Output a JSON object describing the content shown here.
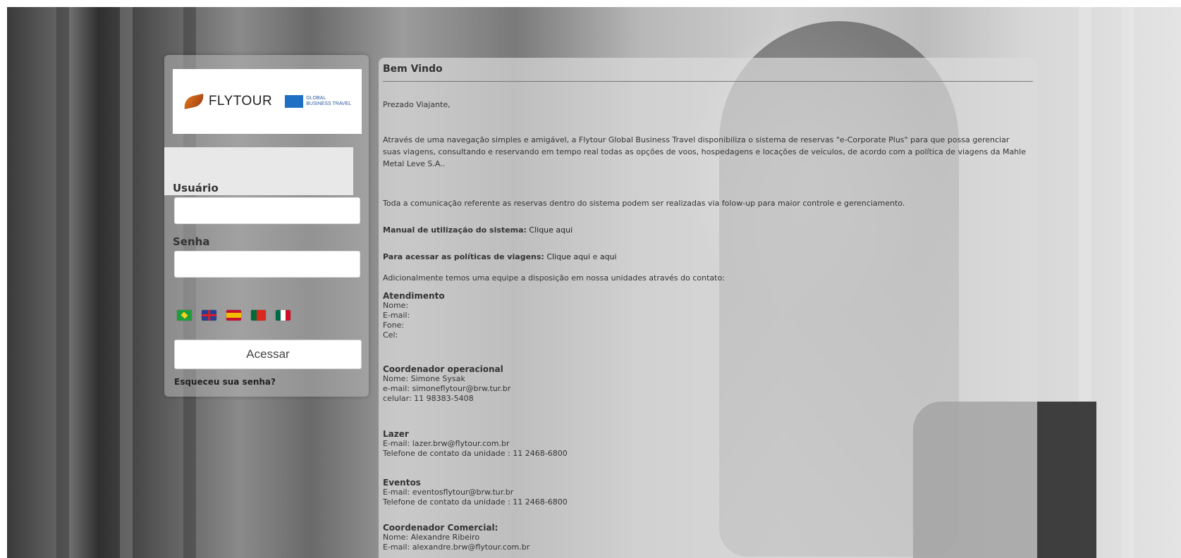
{
  "login": {
    "logo_brand": "FLYTOUR",
    "logo_partner_line1": "GLOBAL",
    "logo_partner_line2": "BUSINESS TRAVEL",
    "user_label": "Usuário",
    "user_value": "",
    "password_label": "Senha",
    "password_value": "",
    "languages": [
      "pt-BR",
      "en",
      "es",
      "pt-PT",
      "es-MX"
    ],
    "submit_label": "Acessar",
    "forgot_label": "Esqueceu sua senha?"
  },
  "welcome": {
    "title": "Bem Vindo",
    "greeting": "Prezado Viajante,",
    "intro": "Através de uma navegação simples e amigável, a Flytour Global Business Travel disponibiliza o sistema de reservas \"e-Corporate Plus\" para que possa gerenciar suas viagens, consultando e reservando em tempo real todas as opções de voos, hospedagens e locações de veículos, de acordo com a política de viagens da Mahle Metal Leve S.A..",
    "followup": "Toda a comunicação referente as reservas dentro do sistema podem ser realizadas via folow-up  para maior controle e gerenciamento.",
    "manual_label": "Manual de utilização do sistema:",
    "manual_link": "Clique aqui",
    "policy_label": "Para acessar as políticas de viagens:",
    "policy_link1": "Clique aqui",
    "policy_sep": "e",
    "policy_link2": "aqui",
    "team_text": "Adicionalmente  temos uma equipe a disposição  em nossa  unidades através do contato:",
    "contacts": [
      {
        "title": "Atendimento",
        "lines": [
          "Nome:",
          "E-mail:",
          "Fone:",
          "Cel:"
        ]
      },
      {
        "title": "Coordenador operacional",
        "lines": [
          "Nome: Simone Sysak",
          "e-mail: simoneflytour@brw.tur.br",
          "celular: 11 98383-5408"
        ]
      },
      {
        "title": "Lazer",
        "lines": [
          "E-mail: lazer.brw@flytour.com.br",
          "Telefone de contato da unidade : 11 2468-6800"
        ]
      },
      {
        "title": "Eventos",
        "lines": [
          "E-mail: eventosflytour@brw.tur.br",
          "Telefone de contato da unidade : 11 2468-6800"
        ]
      },
      {
        "title": "Coordenador Comercial:",
        "lines": [
          "Nome: Alexandre Ribeiro",
          "E-mail: alexandre.brw@flytour.com.br"
        ]
      }
    ]
  }
}
